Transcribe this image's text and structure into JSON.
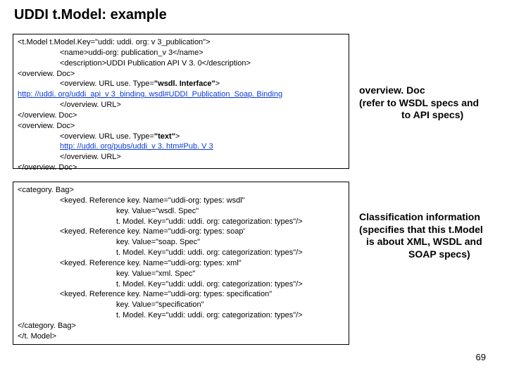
{
  "title": "UDDI t.Model: example",
  "box1": {
    "l1": "<t.Model t.Model.Key=\"uddi: uddi. org: v 3_publication\">",
    "l2": "<name>uddi-org: publication_v 3</name>",
    "l3": "<description>UDDI Publication API V 3. 0</description>",
    "l4": "<overview. Doc>",
    "l5a": "<overview. URL use. Type=",
    "l5b": "\"wsdl. Interface\"",
    "l5c": ">",
    "l6": "http: //uddi. org/uddi_api_v 3_binding. wsdl#UDDI_Publication_Soap. Binding",
    "l7": "</overview. URL>",
    "l8": "</overview. Doc>",
    "l9": "<overview. Doc>",
    "l10a": "<overview. URL use. Type=",
    "l10b": "\"text\"",
    "l10c": ">",
    "l11": "http: //uddi. org/pubs/uddi_v 3. htm#Pub. V 3",
    "l12": "</overview. URL>",
    "l13": "</overview. Doc>"
  },
  "box2": {
    "l1": "<category. Bag>",
    "l2": "<keyed. Reference key. Name=\"uddi-org: types: wsdl\"",
    "l3": "key. Value=\"wsdl. Spec\"",
    "l4": "t. Model. Key=\"uddi: uddi. org: categorization: types\"/>",
    "l5": "<keyed. Reference key. Name=\"uddi-org: types: soap'",
    "l6": "key. Value=\"soap. Spec\"",
    "l7": "t. Model. Key=\"uddi: uddi. org: categorization: types\"/>",
    "l8": "<keyed. Reference key. Name=\"uddi-org: types: xml\"",
    "l9": "key. Value=\"xml. Spec\"",
    "l10": "t. Model. Key=\"uddi: uddi. org: categorization: types\"/>",
    "l11": "<keyed. Reference key. Name=\"uddi-org: types: specification\"",
    "l12": "key. Value=\"specification\"",
    "l13": "t. Model. Key=\"uddi: uddi. org: categorization: types\"/>",
    "l14": "</category. Bag>",
    "l15": "</t. Model>"
  },
  "aside1": {
    "l1": "overview. Doc",
    "l2": "(refer to WSDL specs and",
    "l3": "to API specs)"
  },
  "aside2": {
    "l1": "Classification information",
    "l2": "(specifies that this t.Model",
    "l3": "is about XML, WSDL and",
    "l4": "SOAP specs)"
  },
  "pagenum": "69"
}
